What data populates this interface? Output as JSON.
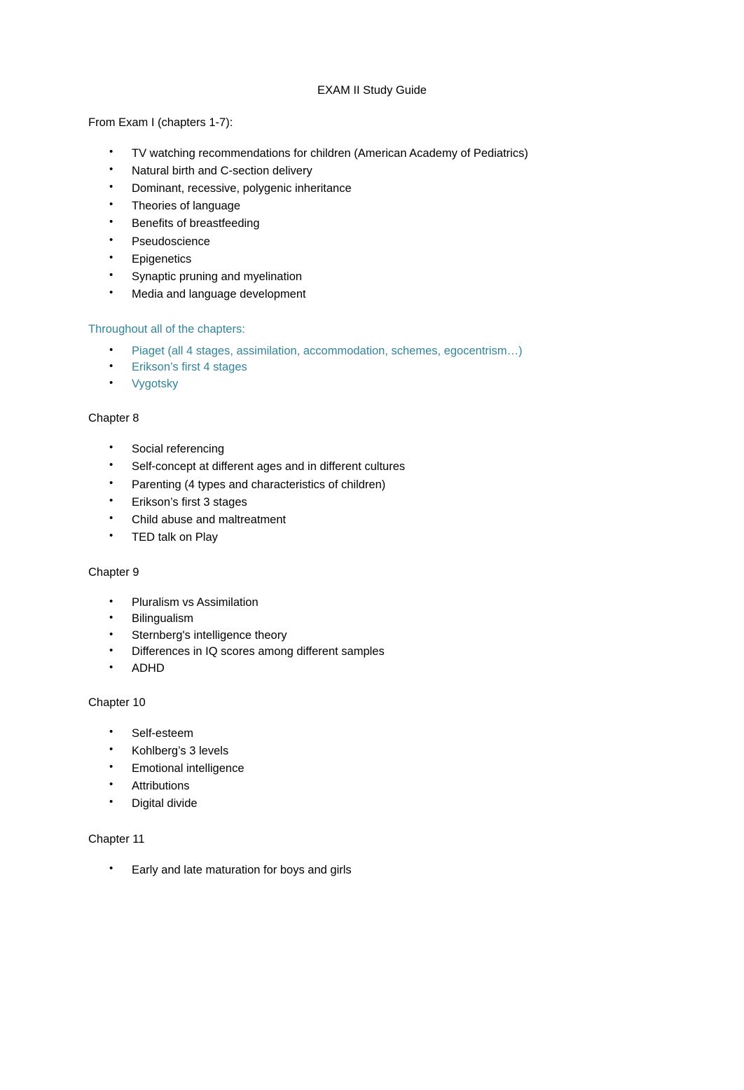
{
  "document": {
    "title": "EXAM II Study Guide",
    "sections": [
      {
        "heading": "From Exam I (chapters 1-7):",
        "color": "#000000",
        "items": [
          "TV watching recommendations for children (American Academy of Pediatrics)",
          "Natural birth and C-section delivery",
          "Dominant, recessive, polygenic inheritance",
          "Theories of language",
          "Benefits of breastfeeding",
          "Pseudoscience",
          "Epigenetics",
          "Synaptic pruning and myelination",
          "Media and language development"
        ]
      },
      {
        "heading": "Throughout all of the chapters:",
        "color": "#31849b",
        "items": [
          "Piaget (all 4 stages, assimilation, accommodation, schemes, egocentrism…)",
          "Erikson’s first 4 stages",
          "Vygotsky"
        ]
      },
      {
        "heading": "Chapter 8",
        "color": "#000000",
        "items": [
          "Social referencing",
          "Self-concept at different ages and in different cultures",
          "Parenting (4 types and characteristics of children)",
          "Erikson’s first 3 stages",
          "Child abuse and maltreatment",
          "TED talk on Play"
        ]
      },
      {
        "heading": "Chapter 9",
        "color": "#000000",
        "items": [
          "Pluralism vs Assimilation",
          "Bilingualism",
          "Sternberg's intelligence theory",
          "Differences in IQ scores among different samples",
          "ADHD"
        ]
      },
      {
        "heading": "Chapter 10",
        "color": "#000000",
        "items": [
          "Self-esteem",
          "Kohlberg’s 3 levels",
          "Emotional intelligence",
          "Attributions",
          "Digital divide"
        ]
      },
      {
        "heading": "Chapter 11",
        "color": "#000000",
        "items": [
          "Early and late maturation for boys and girls"
        ]
      }
    ]
  }
}
